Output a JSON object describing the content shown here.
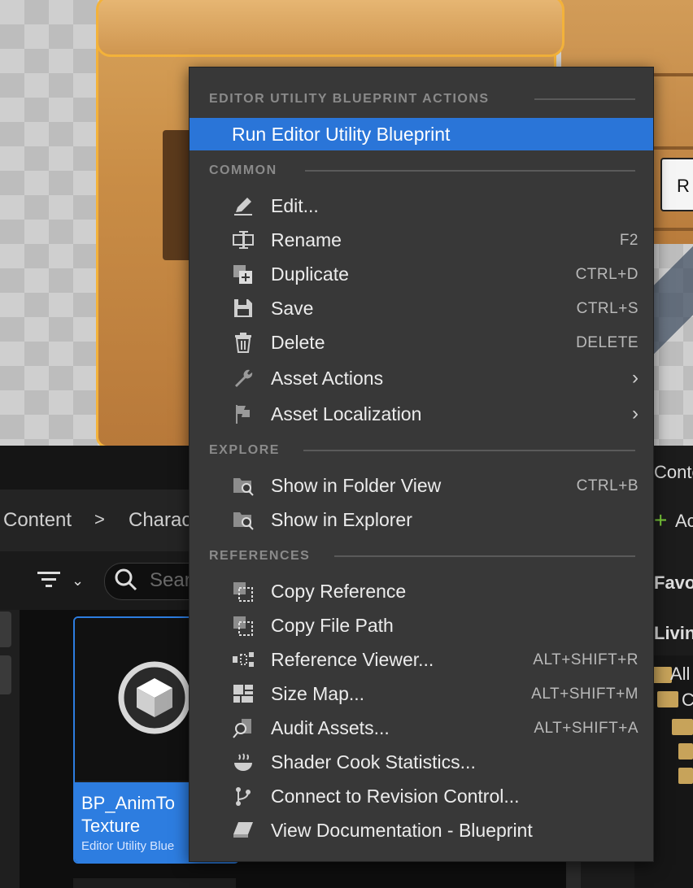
{
  "background": {
    "viewport_label_fragment": "R",
    "content_browser": {
      "breadcrumb": [
        "Content",
        "Charac"
      ],
      "search_placeholder": "Sear",
      "asset": {
        "name": "BP_AnimTo Texture",
        "type": "Editor Utility Blue"
      },
      "right_panel": {
        "header_fragment": "Conte",
        "add_label": "Ac",
        "favorites_fragment": "Favo",
        "living_fragment": "Livin",
        "all_fragment": "All",
        "tree_fragment": "C"
      }
    }
  },
  "menu": {
    "sections": {
      "editor_utility": "EDITOR UTILITY BLUEPRINT ACTIONS",
      "common": "COMMON",
      "explore": "EXPLORE",
      "references": "REFERENCES"
    },
    "run": {
      "label": "Run Editor Utility Blueprint"
    },
    "common_items": [
      {
        "label": "Edit...",
        "shortcut": "",
        "icon": "pencil-icon"
      },
      {
        "label": "Rename",
        "shortcut": "F2",
        "icon": "rename-icon"
      },
      {
        "label": "Duplicate",
        "shortcut": "CTRL+D",
        "icon": "duplicate-icon"
      },
      {
        "label": "Save",
        "shortcut": "CTRL+S",
        "icon": "save-icon"
      },
      {
        "label": "Delete",
        "shortcut": "DELETE",
        "icon": "trash-icon"
      },
      {
        "label": "Asset Actions",
        "shortcut": "",
        "icon": "wrench-icon",
        "submenu": true
      },
      {
        "label": "Asset Localization",
        "shortcut": "",
        "icon": "flag-icon",
        "submenu": true
      }
    ],
    "explore_items": [
      {
        "label": "Show in Folder View",
        "shortcut": "CTRL+B",
        "icon": "folder-search-icon"
      },
      {
        "label": "Show in Explorer",
        "shortcut": "",
        "icon": "folder-search-icon"
      }
    ],
    "reference_items": [
      {
        "label": "Copy Reference",
        "shortcut": "",
        "icon": "copy-reference-icon"
      },
      {
        "label": "Copy File Path",
        "shortcut": "",
        "icon": "copy-path-icon"
      },
      {
        "label": "Reference Viewer...",
        "shortcut": "ALT+SHIFT+R",
        "icon": "reference-viewer-icon"
      },
      {
        "label": "Size Map...",
        "shortcut": "ALT+SHIFT+M",
        "icon": "size-map-icon"
      },
      {
        "label": "Audit Assets...",
        "shortcut": "ALT+SHIFT+A",
        "icon": "audit-icon"
      },
      {
        "label": "Shader Cook Statistics...",
        "shortcut": "",
        "icon": "shader-icon"
      },
      {
        "label": "Connect to Revision Control...",
        "shortcut": "",
        "icon": "branch-icon"
      },
      {
        "label": "View Documentation - Blueprint",
        "shortcut": "",
        "icon": "book-icon"
      }
    ]
  },
  "colors": {
    "menu_bg": "#383838",
    "highlight": "#2a75d8",
    "asset_tile_accent": "#2d7de0"
  }
}
